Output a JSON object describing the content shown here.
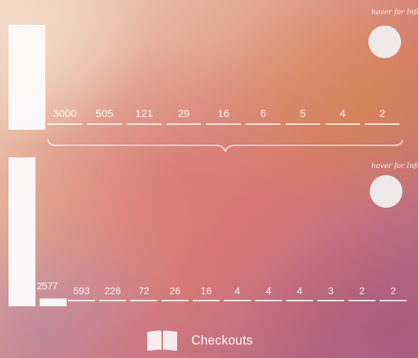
{
  "top_panel": {
    "hover_text": "hover for Info",
    "values": [
      "3000",
      "505",
      "121",
      "29",
      "16",
      "6",
      "5",
      "4",
      "2"
    ]
  },
  "bottom_panel": {
    "hover_text": "hover for Info",
    "first_value": "2577",
    "values": [
      "593",
      "226",
      "72",
      "26",
      "16",
      "4",
      "4",
      "4",
      "3",
      "2",
      "2"
    ]
  },
  "footer": {
    "label": "Checkouts",
    "icon": "open-book-icon"
  },
  "colors": {
    "text": "#ffffff",
    "bar": "#fafafa",
    "background_peach": "#efd2c0",
    "background_rose": "#d67a78",
    "background_mauve": "#a56a8c"
  }
}
